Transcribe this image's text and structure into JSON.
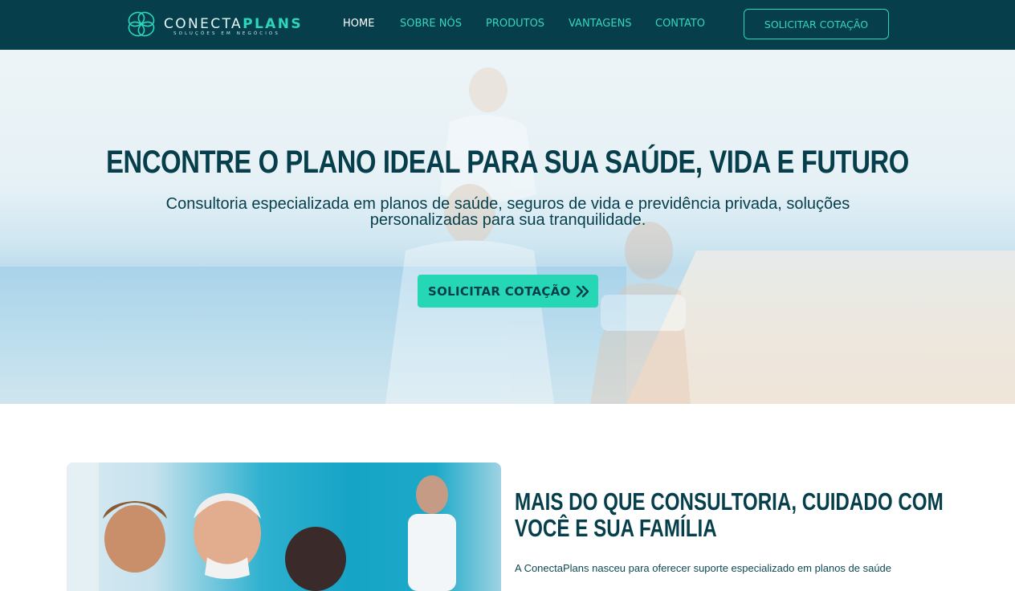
{
  "nav": {
    "logo": {
      "name_light": "CONECTA",
      "name_bold": "PLANS",
      "tagline": "SOLUÇÕES EM NEGÓCIOS"
    },
    "links": [
      {
        "label": "HOME",
        "active": true
      },
      {
        "label": "SOBRE NÓS",
        "active": false
      },
      {
        "label": "PRODUTOS",
        "active": false
      },
      {
        "label": "VANTAGENS",
        "active": false
      },
      {
        "label": "CONTATO",
        "active": false
      }
    ],
    "cta_label": "SOLICITAR COTAÇÃO"
  },
  "hero": {
    "title": "ENCONTRE O PLANO IDEAL PARA SUA SAÚDE, VIDA E FUTURO",
    "subtitle": "Consultoria especializada em planos de saúde, seguros de vida e previdência privada, soluções personalizadas para sua tranquilidade.",
    "cta_label": "SOLICITAR COTAÇÃO",
    "cta_icon": "double-chevron-right-icon"
  },
  "about": {
    "title_line1": "MAIS DO QUE CONSULTORIA, CUIDADO COM",
    "title_line2": "VOCÊ E SUA FAMÍLIA",
    "text": "A ConectaPlans nasceu para oferecer suporte especializado em planos de saúde"
  },
  "colors": {
    "navy": "#063f4b",
    "accent": "#26d7b5",
    "white": "#ffffff"
  }
}
